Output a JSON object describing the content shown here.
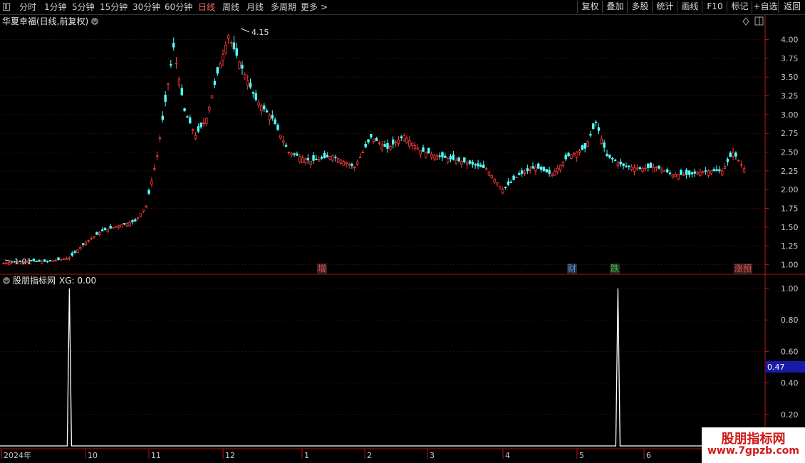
{
  "toolbar": {
    "periods": [
      "分时",
      "1分钟",
      "5分钟",
      "15分钟",
      "30分钟",
      "60分钟",
      "日线",
      "周线",
      "月线",
      "多周期",
      "更多 >"
    ],
    "active_period": "日线",
    "buttons": [
      "复权",
      "叠加",
      "多股",
      "统计",
      "画线",
      "F10",
      "标记",
      "+自选",
      "返回"
    ]
  },
  "main_panel": {
    "title": "华夏幸福(日线,前复权)",
    "high_label": "4.15",
    "low_label": "1.01",
    "y_ticks": [
      "4.00",
      "3.75",
      "3.50",
      "3.25",
      "3.00",
      "2.75",
      "2.50",
      "2.25",
      "2.00",
      "1.75",
      "1.50",
      "1.25",
      "1.00"
    ],
    "events": [
      {
        "text": "增",
        "color": "#ff4040"
      },
      {
        "text": "财",
        "color": "#4aa0ff"
      },
      {
        "text": "跌",
        "color": "#30d030"
      },
      {
        "text": "涨预",
        "color": "#ff4040"
      }
    ]
  },
  "indicator_panel": {
    "title": "股朋指标网",
    "xg_label": "XG: 0.00",
    "y_ticks": [
      "1.00",
      "0.80",
      "0.60",
      "0.40",
      "0.20"
    ],
    "cursor_value": "0.47"
  },
  "x_axis": {
    "labels": [
      "2024年",
      "10",
      "11",
      "12",
      "1",
      "2",
      "3",
      "4",
      "5",
      "6"
    ]
  },
  "watermark": {
    "title": "股朋指标网",
    "url": "www.7gpzb.com"
  },
  "colors": {
    "up": "#ff3b3b",
    "down": "#54ffff",
    "grid": "#5a1010",
    "signal_line": "#ffffff"
  },
  "chart_data": {
    "type": "candlestick",
    "ylim": [
      0.9,
      4.3
    ],
    "close_points": [
      [
        0,
        1.02
      ],
      [
        8,
        1.05
      ],
      [
        16,
        1.04
      ],
      [
        24,
        1.09
      ],
      [
        30,
        1.3
      ],
      [
        36,
        1.45
      ],
      [
        42,
        1.52
      ],
      [
        48,
        1.58
      ],
      [
        52,
        1.78
      ],
      [
        56,
        2.45
      ],
      [
        62,
        3.9
      ],
      [
        66,
        3.05
      ],
      [
        70,
        2.72
      ],
      [
        74,
        2.95
      ],
      [
        78,
        3.55
      ],
      [
        82,
        4.05
      ],
      [
        86,
        3.7
      ],
      [
        92,
        3.2
      ],
      [
        98,
        2.95
      ],
      [
        104,
        2.5
      ],
      [
        112,
        2.38
      ],
      [
        120,
        2.45
      ],
      [
        128,
        2.3
      ],
      [
        134,
        2.7
      ],
      [
        140,
        2.55
      ],
      [
        146,
        2.72
      ],
      [
        152,
        2.52
      ],
      [
        158,
        2.45
      ],
      [
        164,
        2.4
      ],
      [
        170,
        2.35
      ],
      [
        176,
        2.28
      ],
      [
        182,
        2.0
      ],
      [
        188,
        2.2
      ],
      [
        194,
        2.3
      ],
      [
        200,
        2.2
      ],
      [
        206,
        2.45
      ],
      [
        212,
        2.55
      ],
      [
        216,
        2.9
      ],
      [
        220,
        2.45
      ],
      [
        226,
        2.32
      ],
      [
        232,
        2.28
      ],
      [
        238,
        2.3
      ],
      [
        244,
        2.2
      ],
      [
        250,
        2.2
      ],
      [
        256,
        2.25
      ],
      [
        262,
        2.25
      ],
      [
        266,
        2.5
      ],
      [
        270,
        2.28
      ]
    ],
    "signal": {
      "name": "XG",
      "x": [
        24,
        224
      ],
      "values": [
        1,
        1
      ]
    }
  }
}
